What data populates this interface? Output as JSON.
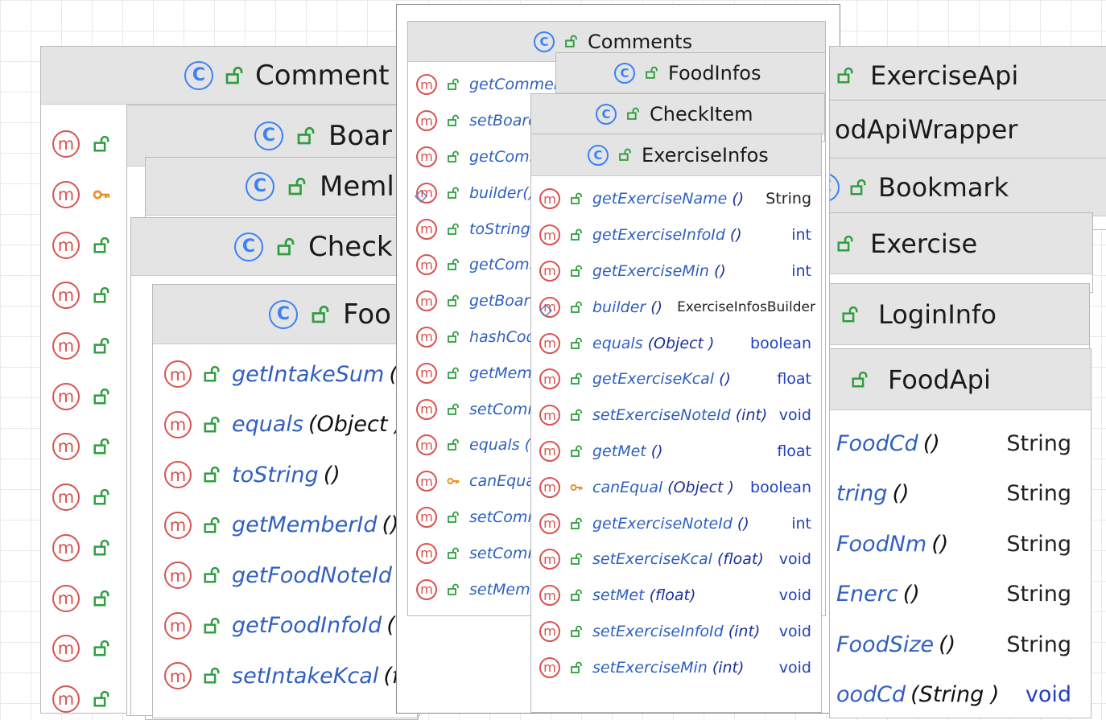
{
  "class_icon_letter": "C",
  "method_icon_letter": "m",
  "colors": {
    "class_icon": "#3b82f6",
    "method_icon": "#d9534f",
    "public_lock": "#2e9e3e",
    "protected_key": "#e8922a",
    "method_name": "#2f5fbf",
    "type_keyword": "#1f3fbf"
  },
  "icons": {
    "class": "class-icon",
    "method": "method-icon",
    "public": "public-lock-icon",
    "protected": "protected-key-icon"
  },
  "classes": {
    "comment": {
      "title": "Comment"
    },
    "board": {
      "title": "Boar"
    },
    "member": {
      "title": "Meml"
    },
    "check": {
      "title": "Check"
    },
    "food": {
      "title": "Foo",
      "methods": [
        {
          "name": "getIntakeSum",
          "params": "("
        },
        {
          "name": "equals",
          "params": "(Object )"
        },
        {
          "name": "toString",
          "params": "()"
        },
        {
          "name": "getMemberId",
          "params": "()"
        },
        {
          "name": "getFoodNoteId",
          "params": ""
        },
        {
          "name": "getFoodInfoId",
          "params": "("
        },
        {
          "name": "setIntakeKcal",
          "params": "(fl"
        }
      ]
    },
    "comments": {
      "title": "Comments",
      "methods": [
        {
          "name": "getCommen"
        },
        {
          "name": "setBoard"
        },
        {
          "name": "getComm"
        },
        {
          "name": "builder()"
        },
        {
          "name": "toString"
        },
        {
          "name": "getComr"
        },
        {
          "name": "getBoard"
        },
        {
          "name": "hashCod"
        },
        {
          "name": "getMem"
        },
        {
          "name": "setComn"
        },
        {
          "name": "equals (C"
        },
        {
          "name": "canEqua"
        },
        {
          "name": "setComn"
        },
        {
          "name": "setComn"
        },
        {
          "name": "setMeml"
        }
      ]
    },
    "food_infos": {
      "title": "FoodInfos"
    },
    "check_item": {
      "title": "CheckItem"
    },
    "exercise_infos": {
      "title": "ExerciseInfos",
      "methods": [
        {
          "name": "getExerciseName",
          "params": "()",
          "type": "String"
        },
        {
          "name": "getExerciseInfoId",
          "params": "()",
          "type": "int"
        },
        {
          "name": "getExerciseMin",
          "params": "()",
          "type": "int"
        },
        {
          "name": "builder",
          "params": "()",
          "type": "ExerciseInfosBuilder"
        },
        {
          "name": "equals",
          "params": "(Object )",
          "type": "boolean"
        },
        {
          "name": "getExerciseKcal",
          "params": "()",
          "type": "float"
        },
        {
          "name": "setExerciseNoteId",
          "params": "(int)",
          "type": "void"
        },
        {
          "name": "getMet",
          "params": "()",
          "type": "float"
        },
        {
          "name": "canEqual",
          "params": "(Object )",
          "type": "boolean"
        },
        {
          "name": "getExerciseNoteId",
          "params": "()",
          "type": "int"
        },
        {
          "name": "setExerciseKcal",
          "params": "(float)",
          "type": "void"
        },
        {
          "name": "setMet",
          "params": "(float)",
          "type": "void"
        },
        {
          "name": "setExerciseInfoId",
          "params": "(int)",
          "type": "void"
        },
        {
          "name": "setExerciseMin",
          "params": "(int)",
          "type": "void"
        }
      ]
    },
    "exercise_api": {
      "title": "ExerciseApi"
    },
    "food_api_wrapper": {
      "title": "odApiWrapper"
    },
    "bookmark": {
      "title": "Bookmark"
    },
    "exercise": {
      "title": "Exercise"
    },
    "login_info": {
      "title": "LoginInfo"
    },
    "food_api": {
      "title": "FoodApi",
      "methods": [
        {
          "name": "FoodCd",
          "params": "()",
          "type": "String"
        },
        {
          "name": "tring",
          "params": "()",
          "type": "String"
        },
        {
          "name": "FoodNm",
          "params": "()",
          "type": "String"
        },
        {
          "name": "Enerc",
          "params": "()",
          "type": "String"
        },
        {
          "name": "FoodSize",
          "params": "()",
          "type": "String"
        },
        {
          "name": "oodCd",
          "params": "(String )",
          "type": "void"
        }
      ]
    }
  }
}
